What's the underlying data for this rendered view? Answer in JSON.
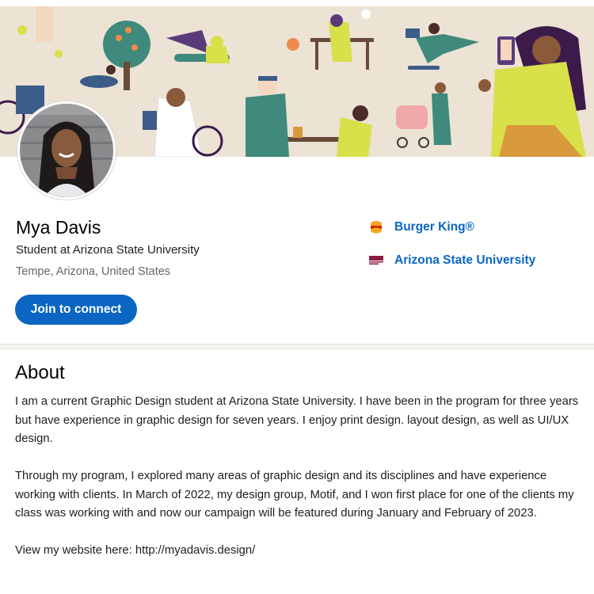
{
  "profile": {
    "name": "Mya Davis",
    "headline": "Student at Arizona State University",
    "location": "Tempe, Arizona, United States",
    "join_label": "Join to connect"
  },
  "companies": [
    {
      "label": "Burger King®",
      "logo": "burger-king-logo"
    },
    {
      "label": "Arizona State University",
      "logo": "asu-logo"
    }
  ],
  "about": {
    "title": "About",
    "paragraphs": [
      "I am a current Graphic Design student at Arizona State University. I have been in the program for three years but have experience in graphic design for seven years. I enjoy print design. layout design, as well as UI/UX design.",
      "Through my program, I explored many areas of graphic design and its disciplines and have experience working with clients. In March of 2022, my design group, Motif, and I won first place for one of the clients my class was working with and now our campaign will be featured during January and February of 2023.",
      "View my website here: http://myadavis.design/"
    ]
  },
  "colors": {
    "accent": "#0a66c2",
    "banner_bg": "#ece3d5"
  }
}
